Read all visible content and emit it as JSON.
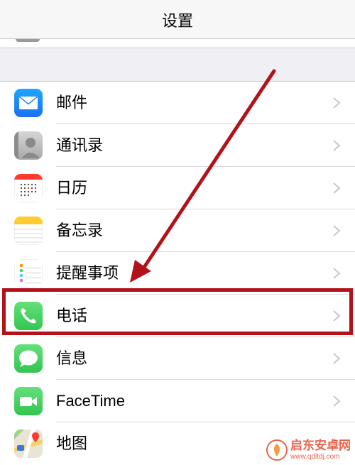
{
  "navbar": {
    "title": "设置"
  },
  "list": {
    "items": [
      {
        "label": "邮件",
        "icon": "mail-icon"
      },
      {
        "label": "通讯录",
        "icon": "contacts-icon"
      },
      {
        "label": "日历",
        "icon": "calendar-icon"
      },
      {
        "label": "备忘录",
        "icon": "notes-icon"
      },
      {
        "label": "提醒事项",
        "icon": "reminders-icon"
      },
      {
        "label": "电话",
        "icon": "phone-icon"
      },
      {
        "label": "信息",
        "icon": "messages-icon"
      },
      {
        "label": "FaceTime",
        "icon": "facetime-icon"
      },
      {
        "label": "地图",
        "icon": "maps-icon"
      }
    ]
  },
  "annotation": {
    "highlighted_item": "电话",
    "color": "#b3121b"
  },
  "watermark": {
    "name": "启东安卓网",
    "url": "www.qdltdj.com"
  },
  "colors": {
    "background": "#efeff4",
    "chevron": "#c7c7cc",
    "phone_green": "#4cd964"
  }
}
